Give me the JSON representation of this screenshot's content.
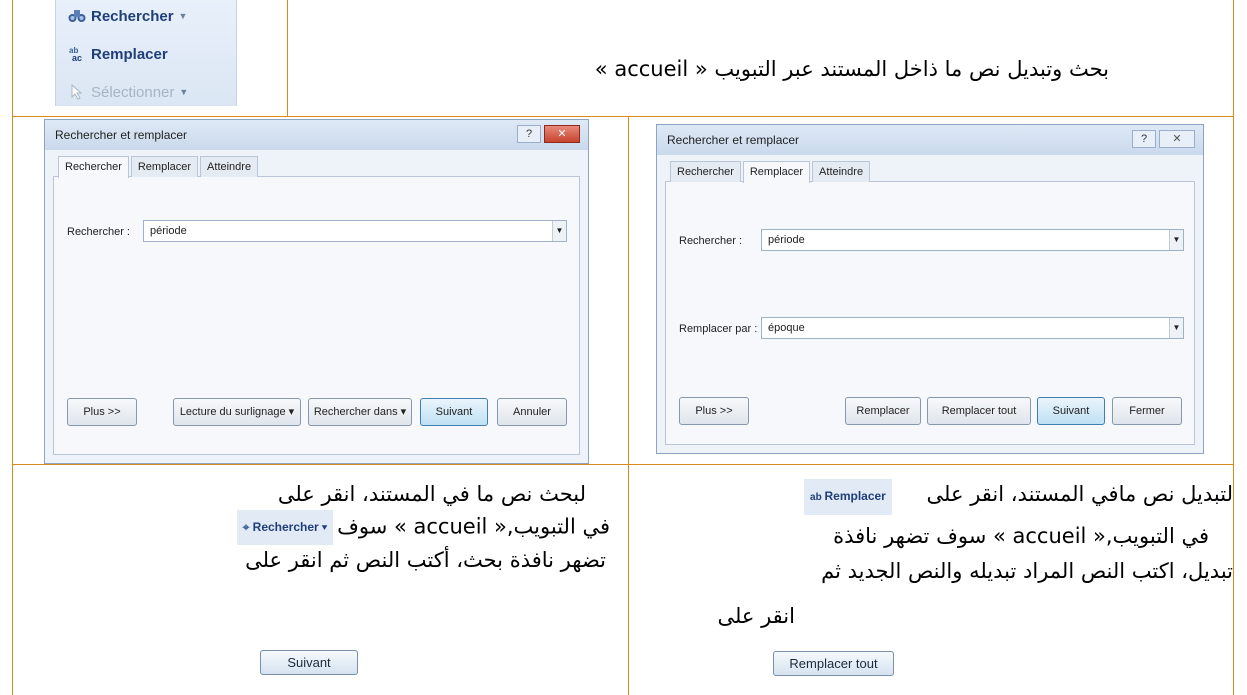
{
  "ribbon": {
    "rechercher_label": "Rechercher",
    "remplacer_label": "Remplacer",
    "selectionner_label": "Sélectionner"
  },
  "heading": "بحث وتبديل نص ما ذاخل المستند عبر التبويب « accueil »",
  "dialog_search": {
    "title": "Rechercher et remplacer",
    "help": "?",
    "close": "✕",
    "tabs": [
      "Rechercher",
      "Remplacer",
      "Atteindre"
    ],
    "find_label": "Rechercher :",
    "find_value": "période",
    "buttons": {
      "more": "Plus >>",
      "reading": "Lecture du surlignage ▾",
      "search_in": "Rechercher dans ▾",
      "next": "Suivant",
      "cancel": "Annuler"
    }
  },
  "dialog_replace": {
    "title": "Rechercher et remplacer",
    "help": "?",
    "close": "✕",
    "tabs": [
      "Rechercher",
      "Remplacer",
      "Atteindre"
    ],
    "find_label": "Rechercher :",
    "find_value": "période",
    "replace_label": "Remplacer par :",
    "replace_value": "époque",
    "buttons": {
      "more": "Plus >>",
      "replace": "Remplacer",
      "replace_all": "Remplacer tout",
      "next": "Suivant",
      "close": "Fermer"
    }
  },
  "left_text": {
    "line1": "لبحث نص ما في المستند، انقر على",
    "line2_a": "في التبويب,« accueil » سوف",
    "line3": "تضهر نافذة بحث، أكتب النص ثم انقر على",
    "inline_button": "Rechercher",
    "image_button": "Suivant"
  },
  "right_text": {
    "line1": "لتبديل نص مافي المستند، انقر على",
    "line2": "في التبويب,« accueil » سوف تضهر نافذة",
    "line3": "تبديل، اكتب النص المراد تبديله والنص الجديد ثم",
    "line4": "انقر على",
    "inline_button": "Remplacer",
    "image_button": "Remplacer tout"
  }
}
